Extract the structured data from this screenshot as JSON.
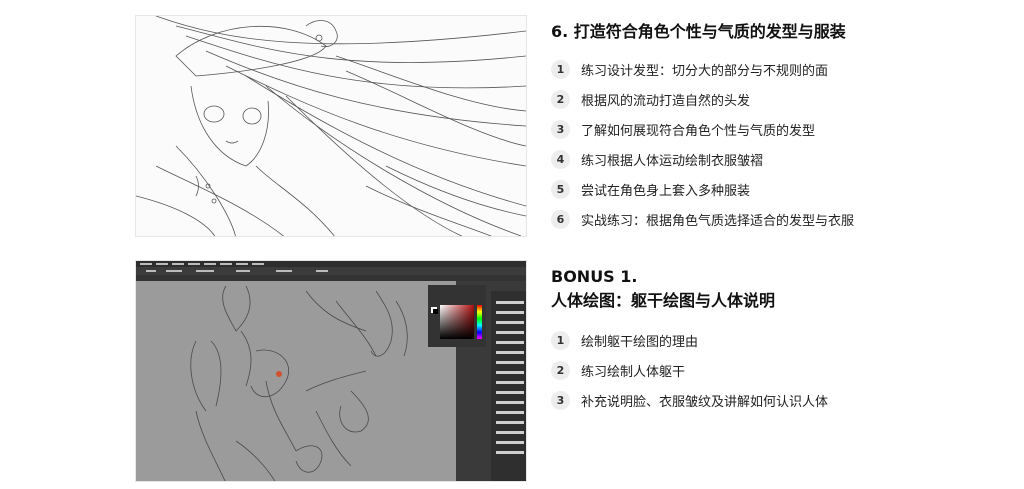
{
  "section1": {
    "title": "6. 打造符合角色个性与气质的发型与服装",
    "items": [
      {
        "num": "1",
        "label": "练习设计发型：切分大的部分与不规则的面"
      },
      {
        "num": "2",
        "label": "根据风的流动打造自然的头发"
      },
      {
        "num": "3",
        "label": "了解如何展现符合角色个性与气质的发型"
      },
      {
        "num": "4",
        "label": "练习根据人体运动绘制衣服皱褶"
      },
      {
        "num": "5",
        "label": "尝试在角色身上套入多种服装"
      },
      {
        "num": "6",
        "label": "实战练习：根据角色气质选择适合的发型与衣服"
      }
    ]
  },
  "section2": {
    "title": "BONUS 1.",
    "subtitle": "人体绘图：躯干绘图与人体说明",
    "items": [
      {
        "num": "1",
        "label": "绘制躯干绘图的理由"
      },
      {
        "num": "2",
        "label": "练习绘制人体躯干"
      },
      {
        "num": "3",
        "label": "补充说明脸、衣服皱纹及讲解如何认识人体"
      }
    ]
  },
  "colors": {
    "canvas_gray": "#9b9b9b",
    "app_dark": "#3a3a3a",
    "sketch_line": "#4a4a4a",
    "number_bg": "#ededed"
  }
}
